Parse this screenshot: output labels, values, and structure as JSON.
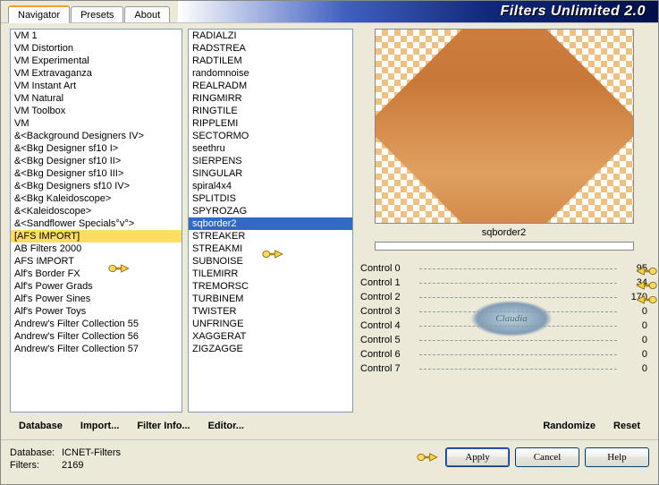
{
  "app": {
    "title": "Filters Unlimited 2.0"
  },
  "tabs": [
    {
      "label": "Navigator",
      "active": true
    },
    {
      "label": "Presets",
      "active": false
    },
    {
      "label": "About",
      "active": false
    }
  ],
  "categories": {
    "items": [
      "VM 1",
      "VM Distortion",
      "VM Experimental",
      "VM Extravaganza",
      "VM Instant Art",
      "VM Natural",
      "VM Toolbox",
      "VM",
      "&<Background Designers IV>",
      "&<Bkg Designer sf10 I>",
      "&<Bkg Designer sf10 II>",
      "&<Bkg Designer sf10 III>",
      "&<Bkg Designers sf10 IV>",
      "&<Bkg Kaleidoscope>",
      "&<Kaleidoscope>",
      "&<Sandflower Specials°v°>",
      "[AFS IMPORT]",
      "AB Filters 2000",
      "AFS IMPORT",
      "Alf's Border FX",
      "Alf's Power Grads",
      "Alf's Power Sines",
      "Alf's Power Toys",
      "Andrew's Filter Collection 55",
      "Andrew's Filter Collection 56",
      "Andrew's Filter Collection 57"
    ],
    "selected": "[AFS IMPORT]"
  },
  "filters": {
    "items": [
      "RADIALZI",
      "RADSTREA",
      "RADTILEM",
      "randomnoise",
      "REALRADM",
      "RINGMIRR",
      "RINGTILE",
      "RIPPLEMI",
      "SECTORMO",
      "seethru",
      "SIERPENS",
      "SINGULAR",
      "spiral4x4",
      "SPLITDIS",
      "SPYROZAG",
      "sqborder2",
      "STREAKER",
      "STREAKMI",
      "SUBNOISE",
      "TILEMIRR",
      "TREMORSC",
      "TURBINEM",
      "TWISTER",
      "UNFRINGE",
      "XAGGERAT",
      "ZIGZAGGE"
    ],
    "selected": "sqborder2"
  },
  "preview": {
    "label": "sqborder2"
  },
  "controls": [
    {
      "label": "Control 0",
      "value": 95
    },
    {
      "label": "Control 1",
      "value": 34
    },
    {
      "label": "Control 2",
      "value": 170
    },
    {
      "label": "Control 3",
      "value": 0
    },
    {
      "label": "Control 4",
      "value": 0
    },
    {
      "label": "Control 5",
      "value": 0
    },
    {
      "label": "Control 6",
      "value": 0
    },
    {
      "label": "Control 7",
      "value": 0
    }
  ],
  "watermark": "Claudia",
  "actions": {
    "database": "Database",
    "import": "Import...",
    "filter_info": "Filter Info...",
    "editor": "Editor...",
    "randomize": "Randomize",
    "reset": "Reset"
  },
  "footer": {
    "db_key": "Database:",
    "db_val": "ICNET-Filters",
    "filters_key": "Filters:",
    "filters_val": "2169",
    "apply": "Apply",
    "cancel": "Cancel",
    "help": "Help"
  }
}
